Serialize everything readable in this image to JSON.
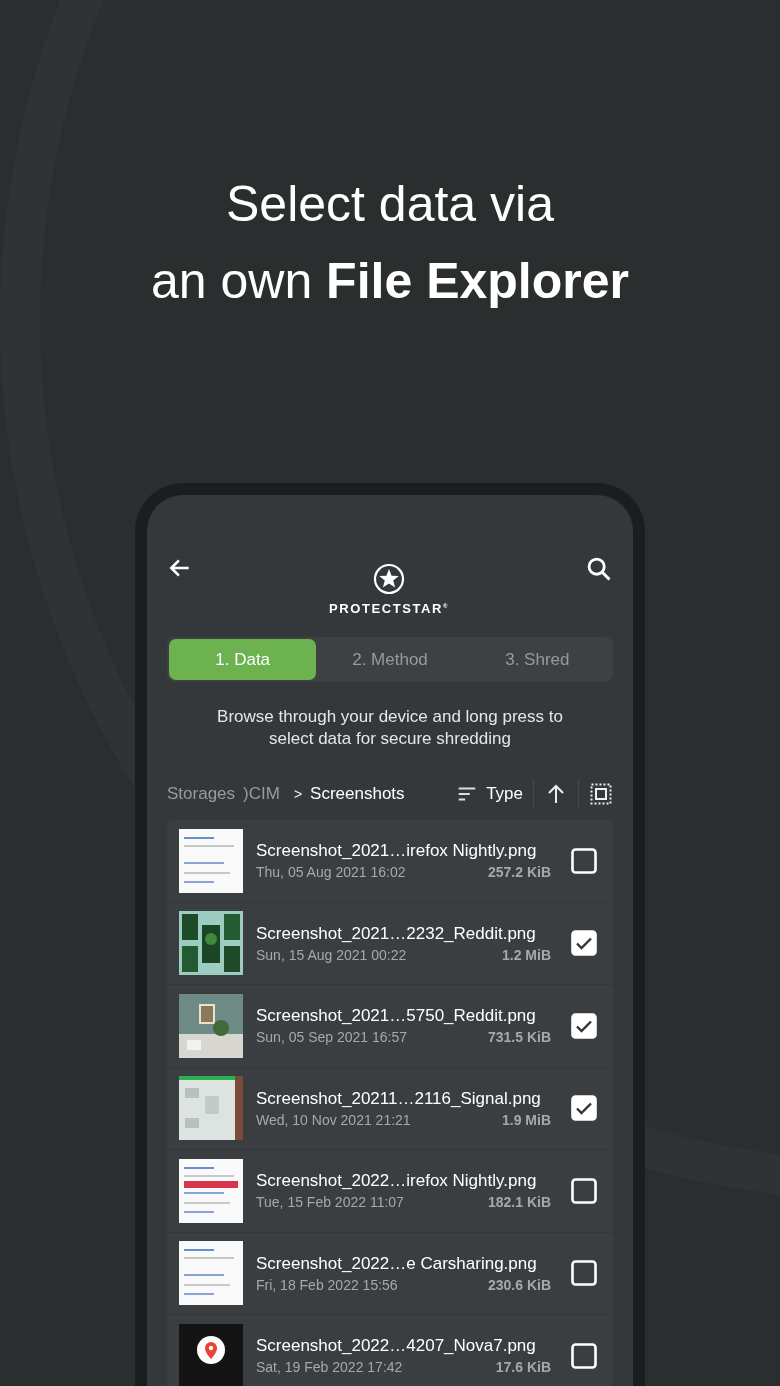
{
  "headline": [
    "Select data via",
    "an own **File Explorer**"
  ],
  "app": {
    "brand": "PROTECTSTAR",
    "brand_mark": "®"
  },
  "steps": [
    {
      "label": "1. Data",
      "selected": true
    },
    {
      "label": "2. Method",
      "selected": false
    },
    {
      "label": "3. Shred",
      "selected": false
    }
  ],
  "description": "Browse through your device and long press to select data for secure shredding",
  "breadcrumb": {
    "items": [
      "Storages",
      ")CIM"
    ],
    "separator": ">",
    "current": "Screenshots"
  },
  "sort": {
    "label": "Type"
  },
  "files": [
    {
      "name": "Screenshot_2021…irefox Nightly.png",
      "date": "Thu, 05 Aug 2021 16:02",
      "size": "257.2 KiB",
      "checked": false
    },
    {
      "name": "Screenshot_2021…2232_Reddit.png",
      "date": "Sun, 15 Aug 2021 00:22",
      "size": "1.2 MiB",
      "checked": true
    },
    {
      "name": "Screenshot_2021…5750_Reddit.png",
      "date": "Sun, 05 Sep 2021 16:57",
      "size": "731.5 KiB",
      "checked": true
    },
    {
      "name": "Screenshot_20211…2116_Signal.png",
      "date": "Wed, 10 Nov 2021 21:21",
      "size": "1.9 MiB",
      "checked": true
    },
    {
      "name": "Screenshot_2022…irefox Nightly.png",
      "date": "Tue, 15 Feb 2022 11:07",
      "size": "182.1 KiB",
      "checked": false
    },
    {
      "name": "Screenshot_2022…e Carsharing.png",
      "date": "Fri, 18 Feb 2022 15:56",
      "size": "230.6 KiB",
      "checked": false
    },
    {
      "name": "Screenshot_2022…4207_Nova7.png",
      "date": "Sat, 19 Feb 2022 17:42",
      "size": "17.6 KiB",
      "checked": false
    }
  ]
}
